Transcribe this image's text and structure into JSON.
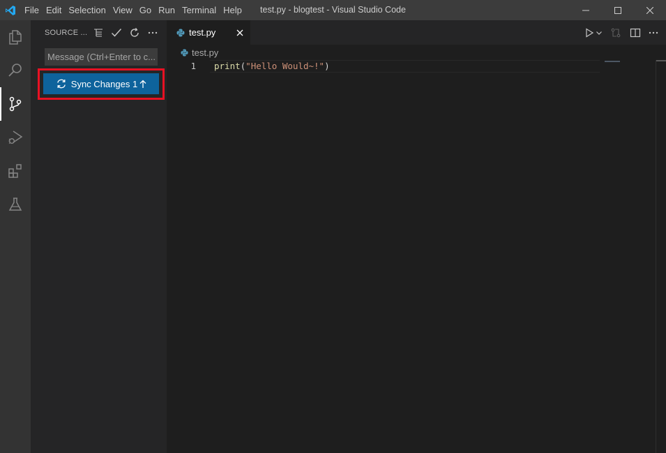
{
  "window": {
    "title": "test.py - blogtest - Visual Studio Code",
    "menu": [
      "File",
      "Edit",
      "Selection",
      "View",
      "Go",
      "Run",
      "Terminal",
      "Help"
    ]
  },
  "activity_bar": {
    "items": [
      {
        "name": "explorer",
        "icon": "files-icon"
      },
      {
        "name": "search",
        "icon": "search-icon"
      },
      {
        "name": "source-control",
        "icon": "source-control-icon",
        "active": true
      },
      {
        "name": "run-and-debug",
        "icon": "run-debug-icon"
      },
      {
        "name": "extensions",
        "icon": "extensions-icon"
      },
      {
        "name": "testing",
        "icon": "flask-icon"
      }
    ]
  },
  "sidebar": {
    "title": "SOURCE ...",
    "commit_placeholder": "Message (Ctrl+Enter to c...",
    "sync_button_label": "Sync Changes 1"
  },
  "editor": {
    "tab_label": "test.py",
    "breadcrumb": "test.py",
    "line_number": "1",
    "code": {
      "fn": "print",
      "open": "(",
      "string": "\"Hello Would~!\"",
      "close": ")"
    }
  },
  "colors": {
    "accent": "#0e639c",
    "highlight": "#e81123",
    "python_icon": "#519aba"
  }
}
